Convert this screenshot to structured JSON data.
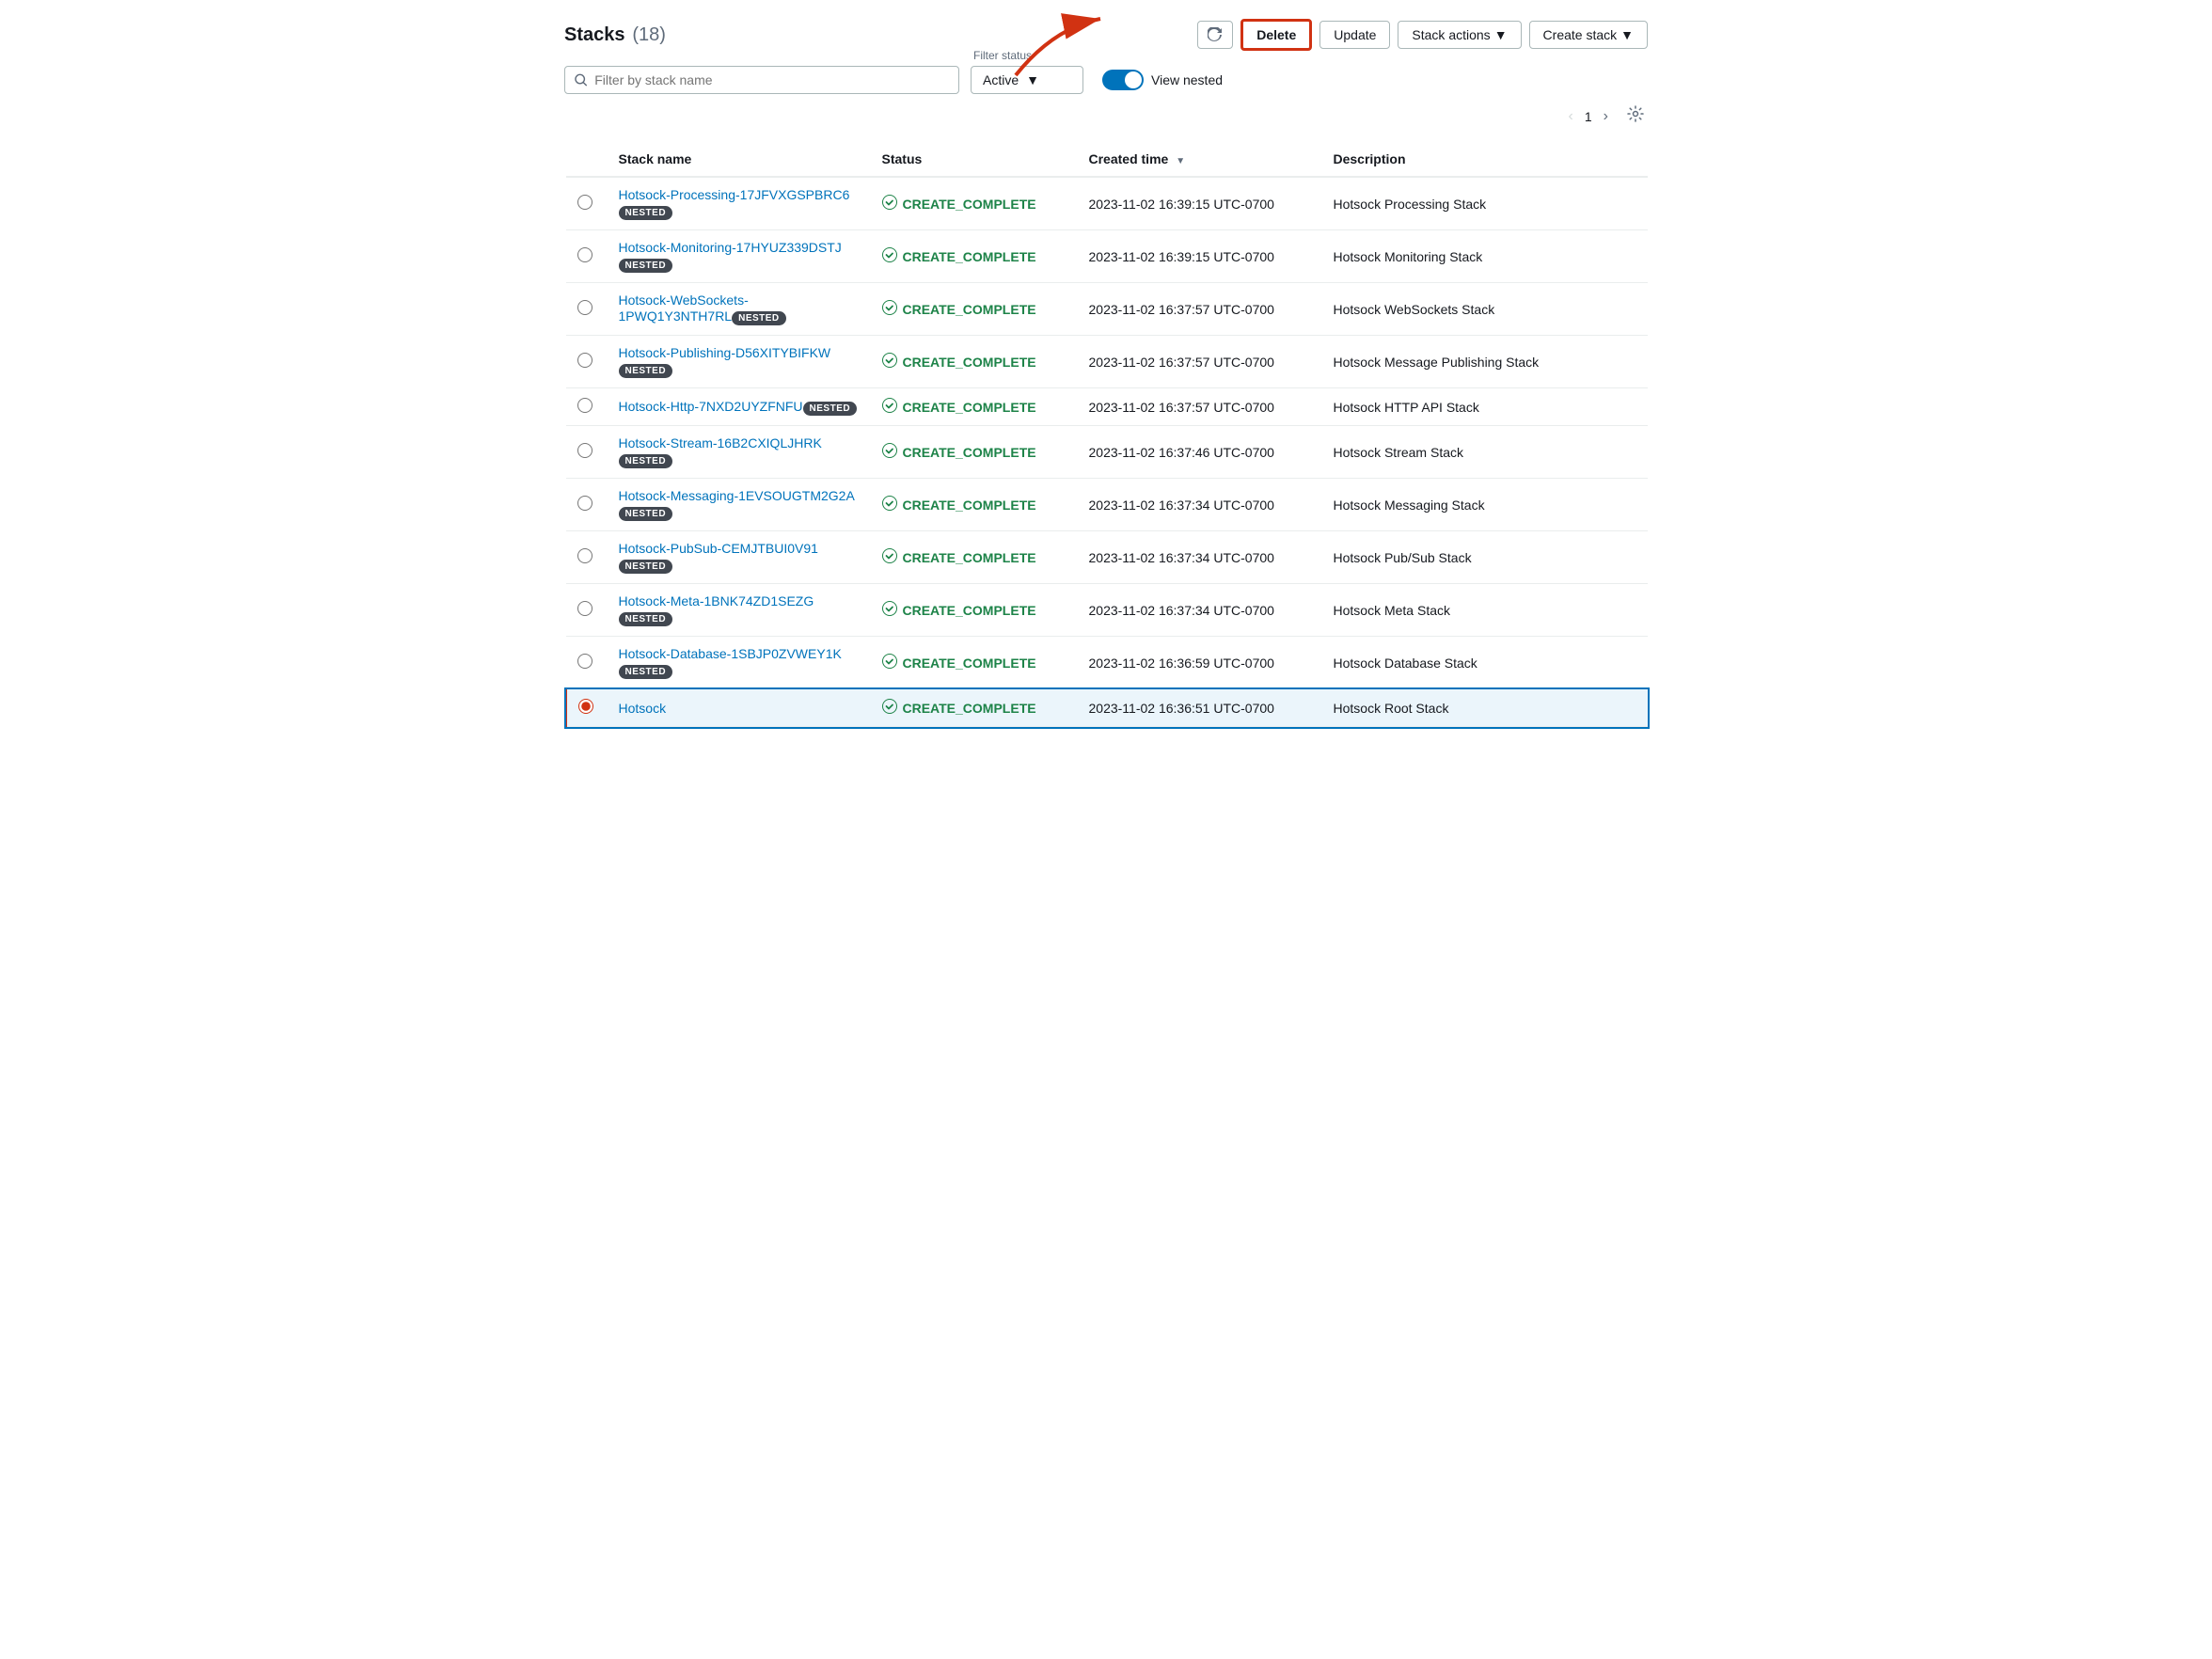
{
  "page": {
    "title": "Stacks",
    "count": "(18)"
  },
  "toolbar": {
    "refresh_label": "↻",
    "delete_label": "Delete",
    "update_label": "Update",
    "stack_actions_label": "Stack actions",
    "create_stack_label": "Create stack",
    "filter_status_label": "Filter status"
  },
  "filter": {
    "placeholder": "Filter by stack name",
    "status_value": "Active",
    "view_nested_label": "View nested",
    "page_number": "1"
  },
  "table": {
    "columns": [
      "Stack name",
      "Status",
      "Created time",
      "Description"
    ],
    "rows": [
      {
        "id": 1,
        "name": "Hotsock-Processing-17JFVXGSPBRC6",
        "nested": true,
        "status": "CREATE_COMPLETE",
        "created": "2023-11-02 16:39:15 UTC-0700",
        "description": "Hotsock Processing Stack",
        "selected": false
      },
      {
        "id": 2,
        "name": "Hotsock-Monitoring-17HYUZ339DSTJ",
        "nested": true,
        "status": "CREATE_COMPLETE",
        "created": "2023-11-02 16:39:15 UTC-0700",
        "description": "Hotsock Monitoring Stack",
        "selected": false
      },
      {
        "id": 3,
        "name": "Hotsock-WebSockets-1PWQ1Y3NTH7RL",
        "nested": true,
        "status": "CREATE_COMPLETE",
        "created": "2023-11-02 16:37:57 UTC-0700",
        "description": "Hotsock WebSockets Stack",
        "selected": false
      },
      {
        "id": 4,
        "name": "Hotsock-Publishing-D56XITYBIFKW",
        "nested": true,
        "status": "CREATE_COMPLETE",
        "created": "2023-11-02 16:37:57 UTC-0700",
        "description": "Hotsock Message Publishing Stack",
        "selected": false
      },
      {
        "id": 5,
        "name": "Hotsock-Http-7NXD2UYZFNFU",
        "nested": true,
        "status": "CREATE_COMPLETE",
        "created": "2023-11-02 16:37:57 UTC-0700",
        "description": "Hotsock HTTP API Stack",
        "selected": false
      },
      {
        "id": 6,
        "name": "Hotsock-Stream-16B2CXIQLJHRK",
        "nested": true,
        "status": "CREATE_COMPLETE",
        "created": "2023-11-02 16:37:46 UTC-0700",
        "description": "Hotsock Stream Stack",
        "selected": false
      },
      {
        "id": 7,
        "name": "Hotsock-Messaging-1EVSOUGTM2G2A",
        "nested": true,
        "status": "CREATE_COMPLETE",
        "created": "2023-11-02 16:37:34 UTC-0700",
        "description": "Hotsock Messaging Stack",
        "selected": false
      },
      {
        "id": 8,
        "name": "Hotsock-PubSub-CEMJTBUI0V91",
        "nested": true,
        "status": "CREATE_COMPLETE",
        "created": "2023-11-02 16:37:34 UTC-0700",
        "description": "Hotsock Pub/Sub Stack",
        "selected": false
      },
      {
        "id": 9,
        "name": "Hotsock-Meta-1BNK74ZD1SEZG",
        "nested": true,
        "status": "CREATE_COMPLETE",
        "created": "2023-11-02 16:37:34 UTC-0700",
        "description": "Hotsock Meta Stack",
        "selected": false
      },
      {
        "id": 10,
        "name": "Hotsock-Database-1SBJP0ZVWEY1K",
        "nested": true,
        "status": "CREATE_COMPLETE",
        "created": "2023-11-02 16:36:59 UTC-0700",
        "description": "Hotsock Database Stack",
        "selected": false
      },
      {
        "id": 11,
        "name": "Hotsock",
        "nested": false,
        "status": "CREATE_COMPLETE",
        "created": "2023-11-02 16:36:51 UTC-0700",
        "description": "Hotsock Root Stack",
        "selected": true
      }
    ],
    "nested_label": "NESTED",
    "status_complete": "CREATE_COMPLETE"
  }
}
